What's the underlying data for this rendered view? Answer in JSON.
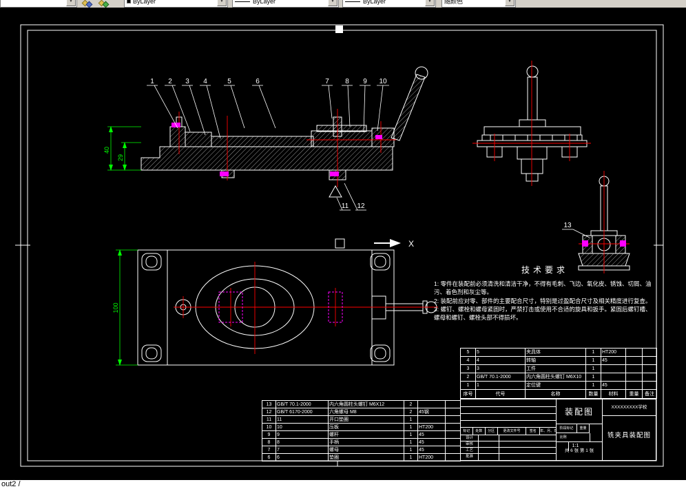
{
  "toolbar": {
    "color_value": "ByLayer",
    "linetype_value": "ByLayer",
    "lineweight_value": "ByLayer",
    "plotstyle_value": "随颜色"
  },
  "statusbar": {
    "layout_label": "out2 /"
  },
  "view_label": "X",
  "dimensions": {
    "height_40": "40",
    "height_29": "29",
    "width_100": "100"
  },
  "callouts": {
    "c1": "1",
    "c2": "2",
    "c3": "3",
    "c4": "4",
    "c5": "5",
    "c6": "6",
    "c7": "7",
    "c8": "8",
    "c9": "9",
    "c10": "10",
    "c11": "11",
    "c12": "12",
    "c13": "13"
  },
  "colors": {
    "line": "#ffffff",
    "dimension": "#00ff00",
    "centerline": "#ff0000",
    "section_mark": "#ff00ff"
  },
  "tech_req": {
    "title": "技术要求",
    "line1": "1: 零件在装配前必须清洗和清洁干净，不得有毛刺、飞边、氧化皮、锈蚀、切屑、油污、着色剂和灰尘等。",
    "line2": "2: 装配前应对零、部件的主要配合尺寸，特别是过盈配合尺寸及相关精度进行复查。",
    "line3": "3: 螺钉、螺栓和螺母紧固时，严禁打击或使用不合适的旋具和扳手。紧固后螺钉槽、螺母和螺钉、螺栓头部不得损坏。"
  },
  "bom_upper": {
    "header": {
      "seq": "序号",
      "code": "代号",
      "name": "名称",
      "qty": "数量",
      "material": "材料",
      "weight": "重量",
      "note": "备注"
    },
    "rows": [
      {
        "seq": "5",
        "code": "5",
        "name": "夹具体",
        "qty": "1",
        "material": "HT200"
      },
      {
        "seq": "4",
        "code": "4",
        "name": "转轴",
        "qty": "1",
        "material": "45"
      },
      {
        "seq": "3",
        "code": "3",
        "name": "工件",
        "qty": "1",
        "material": ""
      },
      {
        "seq": "2",
        "code": "GB/T 70.1-2000",
        "name": "内六角圆柱头螺钉 M6X10",
        "qty": "1",
        "material": ""
      },
      {
        "seq": "1",
        "code": "1",
        "name": "定位键",
        "qty": "1",
        "material": "45"
      }
    ]
  },
  "bom_lower": {
    "rows": [
      {
        "seq": "13",
        "code": "GB/T 70.1-2000",
        "name": "内六角圆柱头螺钉 M6X12",
        "qty": "2",
        "material": ""
      },
      {
        "seq": "12",
        "code": "GB/T 6170-2000",
        "name": "六角螺母 M8",
        "qty": "2",
        "material": "45钢"
      },
      {
        "seq": "11",
        "code": "11",
        "name": "开口垫圈",
        "qty": "1",
        "material": ""
      },
      {
        "seq": "10",
        "code": "10",
        "name": "压板",
        "qty": "1",
        "material": "HT200"
      },
      {
        "seq": "9",
        "code": "9",
        "name": "螺杆",
        "qty": "1",
        "material": "45"
      },
      {
        "seq": "8",
        "code": "8",
        "name": "手柄",
        "qty": "1",
        "material": "45"
      },
      {
        "seq": "7",
        "code": "7",
        "name": "螺母",
        "qty": "1",
        "material": "45"
      },
      {
        "seq": "6",
        "code": "6",
        "name": "垫圈",
        "qty": "1",
        "material": "HT200"
      }
    ]
  },
  "title_block": {
    "doc_type": "装配图",
    "school": "XXXXXXXXX学校",
    "drawing_name": "铣夹具装配图",
    "rev_headers": {
      "mark": "标记",
      "count": "处数",
      "zone": "分区",
      "doc_no": "更改文件号",
      "sign": "签名",
      "date": "年、月、日"
    },
    "roles": {
      "design": "设计",
      "check": "审核",
      "process": "工艺",
      "approve": "批准"
    },
    "stage_label": "阶段标记",
    "weight_label": "重量",
    "scale_label": "比例",
    "scale_value": "1:1",
    "sheets": "共 6 张 第 1 张"
  }
}
